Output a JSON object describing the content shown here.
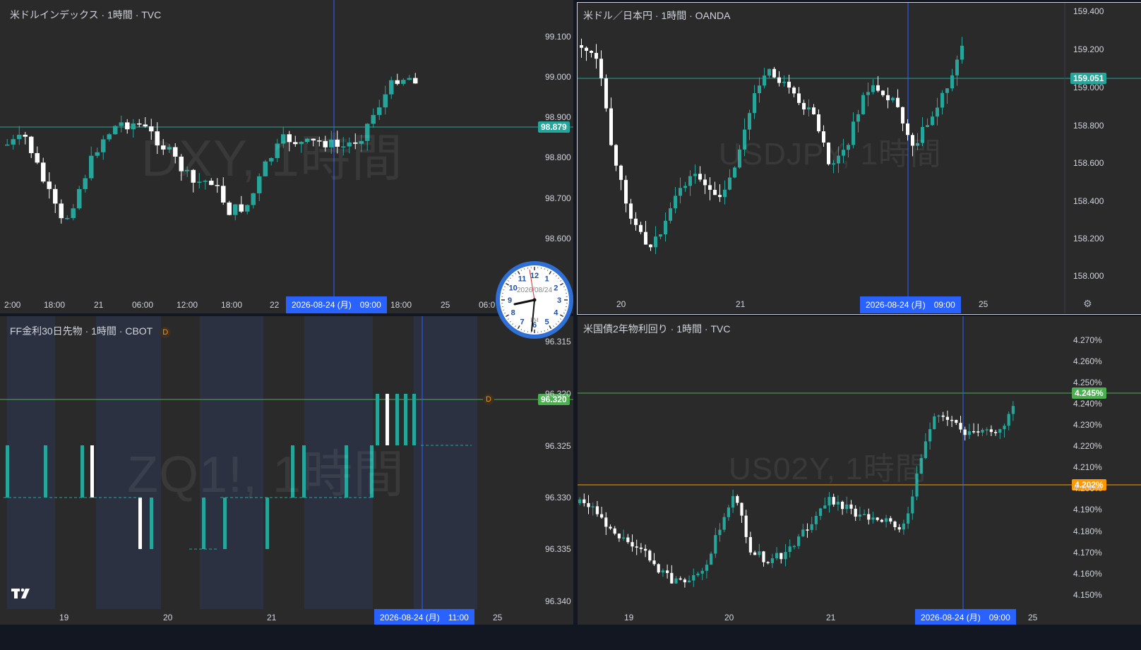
{
  "colors": {
    "up": "#26a69a",
    "down": "#ffffff",
    "crosshair": "#2962ff",
    "pane_bg": "#2a2a2a",
    "shade": "#2b3140",
    "orange": "#ff9800",
    "green_tag": "#4caf50"
  },
  "panes": {
    "dxy": {
      "title": "米ドルインデックス · 1時間 · TVC",
      "watermark": "DXY, 1時間",
      "price_tag": "98.879",
      "y_labels": [
        "99.100",
        "99.000",
        "98.900",
        "98.800",
        "98.700",
        "98.600"
      ],
      "x_labels": [
        "2:00",
        "18:00",
        "21",
        "06:00",
        "12:00",
        "18:00",
        "22",
        "18:00",
        "25",
        "06:0"
      ],
      "date_tag": "2026-08-24 (月)　09:00"
    },
    "usdjpy": {
      "title": "米ドル／日本円 · 1時間 · OANDA",
      "watermark": "USDJPY, 1時間",
      "price_tag": "159.051",
      "y_labels": [
        "159.400",
        "159.200",
        "159.000",
        "158.800",
        "158.600",
        "158.400",
        "158.200",
        "158.000"
      ],
      "x_labels": [
        "20",
        "21",
        "25"
      ],
      "date_tag": "2026-08-24 (月)　09:00",
      "settings_icon": "gear-icon"
    },
    "zq": {
      "title": "FF金利30日先物 · 1時間 · CBOT",
      "badge": "D",
      "marker": "D",
      "watermark": "ZQ1!, 1時間",
      "price_tag": "96.320",
      "y_labels": [
        "96.315",
        "96.320",
        "96.325",
        "96.330",
        "96.335",
        "96.340"
      ],
      "x_labels": [
        "19",
        "20",
        "21",
        "25"
      ],
      "date_tag": "2026-08-24 (月)　11:00"
    },
    "us02y": {
      "title": "米国債2年物利回り · 1時間 · TVC",
      "watermark": "US02Y, 1時間",
      "price_tag_green": "4.245%",
      "price_tag_orange": "4.202%",
      "y_labels": [
        "4.270%",
        "4.260%",
        "4.250%",
        "4.240%",
        "4.230%",
        "4.220%",
        "4.210%",
        "4.200%",
        "4.190%",
        "4.180%",
        "4.170%",
        "4.160%",
        "4.150%"
      ],
      "x_labels": [
        "19",
        "20",
        "21",
        "25"
      ],
      "date_tag": "2026-08-24 (月)　09:00"
    }
  },
  "clock": {
    "date": "2026/08/24",
    "ampm": "PM",
    "numbers": [
      "12",
      "1",
      "2",
      "3",
      "4",
      "5",
      "6",
      "7",
      "8",
      "9",
      "10",
      "11"
    ]
  }
}
